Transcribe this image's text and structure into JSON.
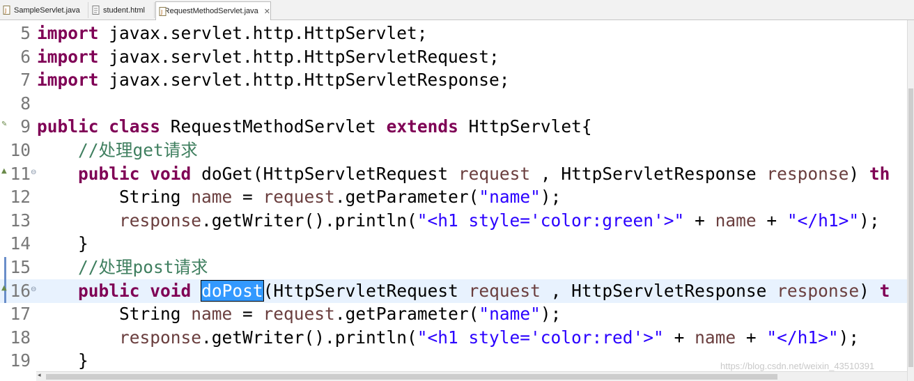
{
  "tabs": [
    {
      "label": "SampleServlet.java",
      "icon": "java-file-icon",
      "active": false
    },
    {
      "label": "student.html",
      "icon": "html-file-icon",
      "active": false
    },
    {
      "label": "RequestMethodServlet.java",
      "icon": "java-file-icon",
      "active": true,
      "close": "✕"
    }
  ],
  "colors": {
    "keyword": "#7f0055",
    "string": "#2a00ff",
    "local_variable": "#6a3e3e",
    "comment": "#3f7f5f",
    "line_number": "#787878",
    "current_line": "#e8f2fe",
    "selection": "#3399ff"
  },
  "editor": {
    "lines": [
      {
        "num": "5",
        "t": [
          [
            "kw",
            "import"
          ],
          [
            "p",
            " javax.servlet.http.HttpServlet;"
          ]
        ]
      },
      {
        "num": "6",
        "t": [
          [
            "kw",
            "import"
          ],
          [
            "p",
            " javax.servlet.http.HttpServletRequest;"
          ]
        ]
      },
      {
        "num": "7",
        "t": [
          [
            "kw",
            "import"
          ],
          [
            "p",
            " javax.servlet.http.HttpServletResponse;"
          ]
        ]
      },
      {
        "num": "8",
        "t": []
      },
      {
        "num": "9",
        "t": [
          [
            "kw",
            "public"
          ],
          [
            "p",
            " "
          ],
          [
            "kw",
            "class"
          ],
          [
            "p",
            " RequestMethodServlet "
          ],
          [
            "kw",
            "extends"
          ],
          [
            "p",
            " HttpServlet{"
          ]
        ]
      },
      {
        "num": "10",
        "t": [
          [
            "p",
            "    "
          ],
          [
            "cm",
            "//处理get请求"
          ]
        ]
      },
      {
        "num": "11",
        "t": [
          [
            "p",
            "    "
          ],
          [
            "kw",
            "public"
          ],
          [
            "p",
            " "
          ],
          [
            "kw",
            "void"
          ],
          [
            "p",
            " doGet(HttpServletRequest "
          ],
          [
            "var",
            "request"
          ],
          [
            "p",
            " , HttpServletResponse "
          ],
          [
            "var",
            "response"
          ],
          [
            "p",
            ") "
          ],
          [
            "kw",
            "th"
          ]
        ]
      },
      {
        "num": "12",
        "t": [
          [
            "p",
            "        String "
          ],
          [
            "var",
            "name"
          ],
          [
            "p",
            " = "
          ],
          [
            "var",
            "request"
          ],
          [
            "p",
            ".getParameter("
          ],
          [
            "str",
            "\"name\""
          ],
          [
            "p",
            ");"
          ]
        ]
      },
      {
        "num": "13",
        "t": [
          [
            "p",
            "        "
          ],
          [
            "var",
            "response"
          ],
          [
            "p",
            ".getWriter().println("
          ],
          [
            "str",
            "\"<h1 style='color:green'>\""
          ],
          [
            "p",
            " + "
          ],
          [
            "var",
            "name"
          ],
          [
            "p",
            " + "
          ],
          [
            "str",
            "\"</h1>\""
          ],
          [
            "p",
            ");"
          ]
        ]
      },
      {
        "num": "14",
        "t": [
          [
            "p",
            "    }"
          ]
        ]
      },
      {
        "num": "15",
        "t": [
          [
            "p",
            "    "
          ],
          [
            "cm",
            "//处理post请求"
          ]
        ]
      },
      {
        "num": "16",
        "t": [
          [
            "p",
            "    "
          ],
          [
            "kw",
            "public"
          ],
          [
            "p",
            " "
          ],
          [
            "kw",
            "void"
          ],
          [
            "p",
            " "
          ],
          [
            "sel",
            "doPost"
          ],
          [
            "p",
            "(HttpServletRequest "
          ],
          [
            "var",
            "request"
          ],
          [
            "p",
            " , HttpServletResponse "
          ],
          [
            "var",
            "response"
          ],
          [
            "p",
            ") "
          ],
          [
            "kw",
            "t"
          ]
        ],
        "current": true
      },
      {
        "num": "17",
        "t": [
          [
            "p",
            "        String "
          ],
          [
            "var",
            "name"
          ],
          [
            "p",
            " = "
          ],
          [
            "var",
            "request"
          ],
          [
            "p",
            ".getParameter("
          ],
          [
            "str",
            "\"name\""
          ],
          [
            "p",
            ");"
          ]
        ]
      },
      {
        "num": "18",
        "t": [
          [
            "p",
            "        "
          ],
          [
            "var",
            "response"
          ],
          [
            "p",
            ".getWriter().println("
          ],
          [
            "str",
            "\"<h1 style='color:red'>\""
          ],
          [
            "p",
            " + "
          ],
          [
            "var",
            "name"
          ],
          [
            "p",
            " + "
          ],
          [
            "str",
            "\"</h1>\""
          ],
          [
            "p",
            ");"
          ]
        ]
      },
      {
        "num": "19",
        "t": [
          [
            "p",
            "    }"
          ]
        ]
      }
    ]
  },
  "watermark": "https://blog.csdn.net/weixin_43510391"
}
